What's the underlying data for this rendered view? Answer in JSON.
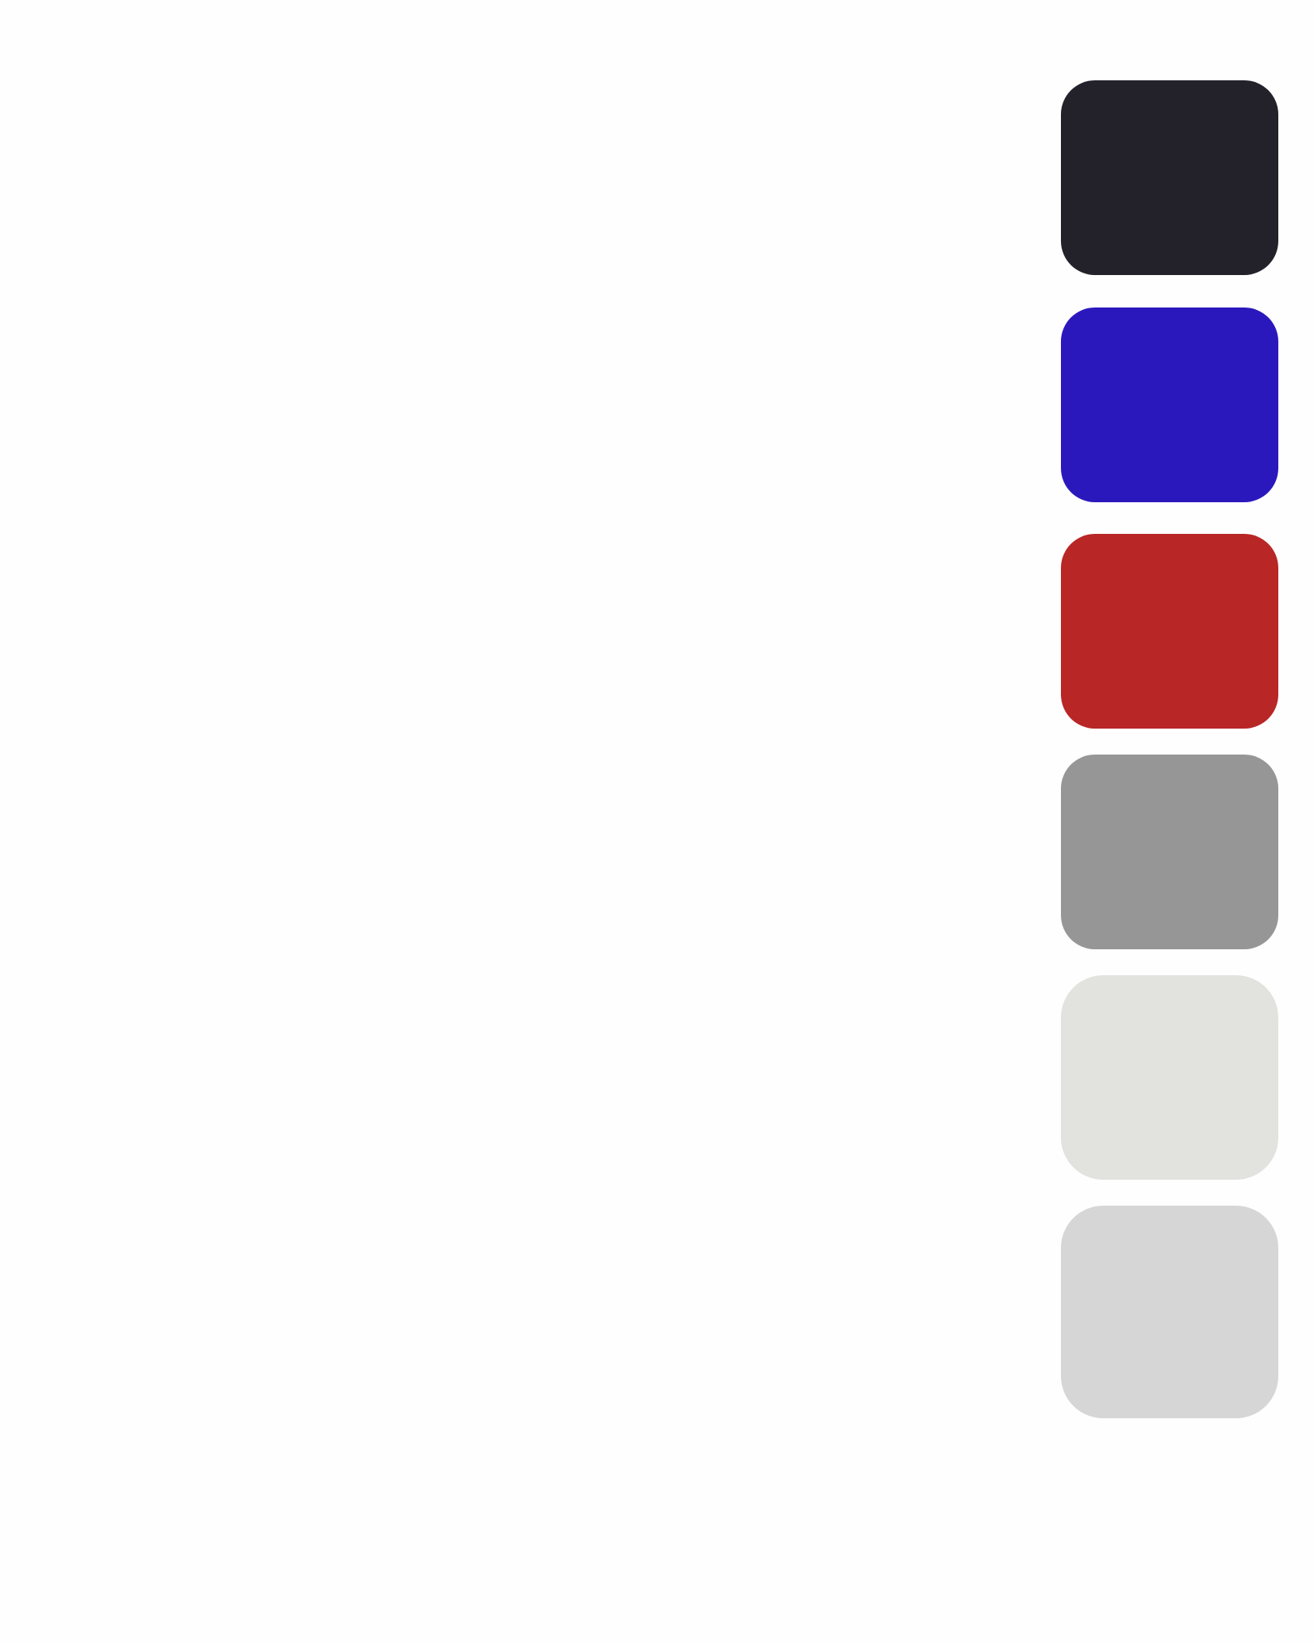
{
  "palette": {
    "swatches": [
      {
        "name": "swatch-dark-navy",
        "color": "#23222b"
      },
      {
        "name": "swatch-blue",
        "color": "#2b18bd"
      },
      {
        "name": "swatch-red",
        "color": "#b92626"
      },
      {
        "name": "swatch-gray",
        "color": "#969696"
      },
      {
        "name": "swatch-light-gray",
        "color": "#e2e2de"
      },
      {
        "name": "swatch-silver",
        "color": "#d6d6d6"
      }
    ]
  }
}
